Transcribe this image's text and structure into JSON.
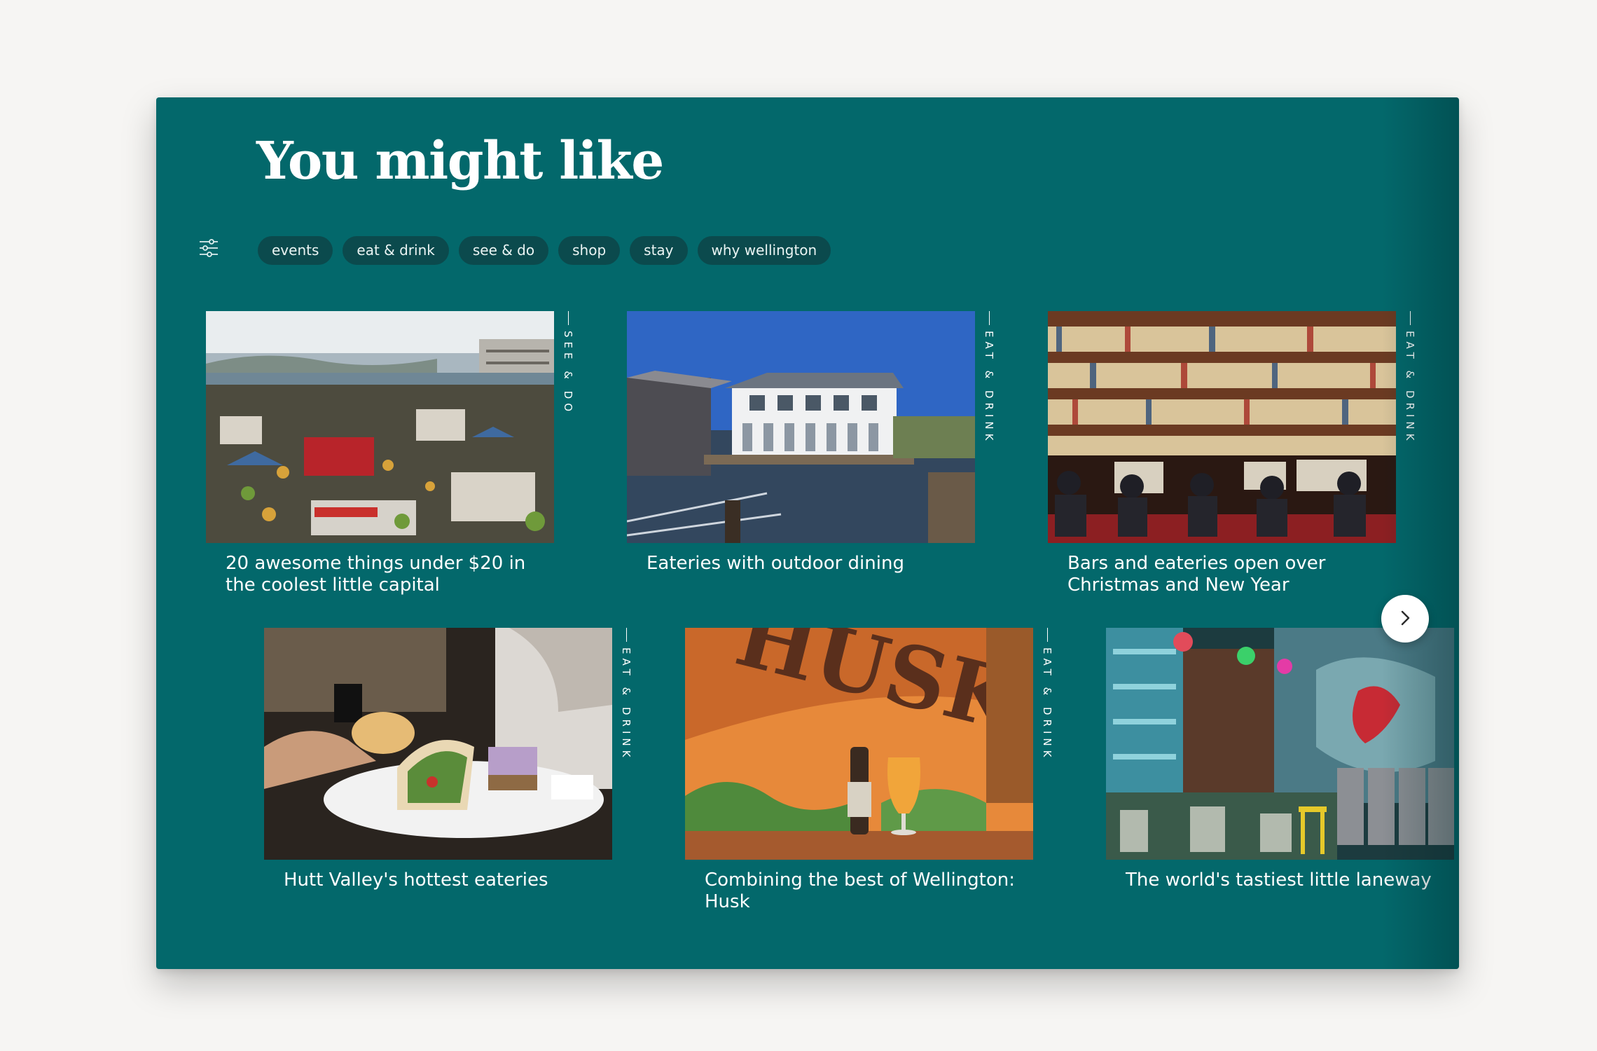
{
  "section": {
    "title": "You might like"
  },
  "filters": {
    "icon": "filter-sliders-icon",
    "chips": [
      "events",
      "eat & drink",
      "see & do",
      "shop",
      "stay",
      "why wellington"
    ]
  },
  "cards": [
    {
      "category": "SEE & DO",
      "title": "20 awesome things under $20 in the coolest little capital"
    },
    {
      "category": "EAT & DRINK",
      "title": "Eateries with outdoor dining"
    },
    {
      "category": "EAT & DRINK",
      "title": "Bars and eateries open over Christmas and New Year"
    },
    {
      "category": "EAT & DRINK",
      "title": "Hutt Valley's hottest eateries"
    },
    {
      "category": "EAT & DRINK",
      "title": "Combining the best of Wellington: Husk"
    },
    {
      "category": "",
      "title": "The world's tastiest little laneway"
    }
  ],
  "carousel": {
    "next_icon": "chevron-right-icon"
  },
  "colors": {
    "panel": "#03686b",
    "chip": "#0b4a4d",
    "page_bg": "#f6f5f3",
    "text": "#ffffff"
  }
}
